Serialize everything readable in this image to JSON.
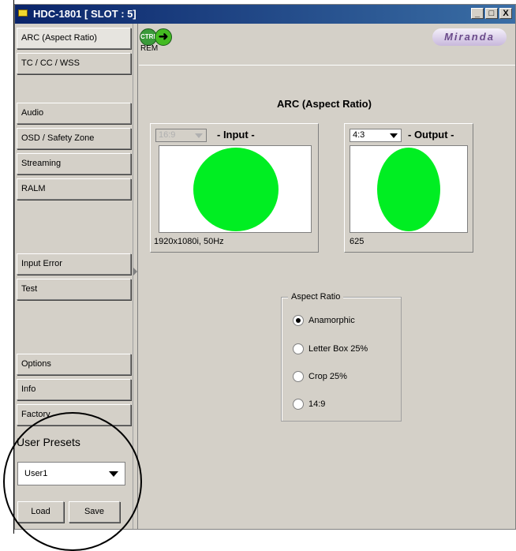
{
  "window": {
    "title": "HDC-1801 [ SLOT : 5]",
    "minimize": "_",
    "maximize": "□",
    "close": "X"
  },
  "sidebar": {
    "items": [
      {
        "label": "ARC (Aspect Ratio)",
        "selected": true
      },
      {
        "label": "TC / CC / WSS"
      },
      {
        "label": "Audio"
      },
      {
        "label": "OSD / Safety Zone"
      },
      {
        "label": "Streaming"
      },
      {
        "label": "RALM"
      },
      {
        "label": "Input Error"
      },
      {
        "label": "Test"
      },
      {
        "label": "Options"
      },
      {
        "label": "Info"
      },
      {
        "label": "Factory"
      }
    ],
    "presets_label": "User Presets",
    "preset_value": "User1",
    "load_label": "Load",
    "save_label": "Save"
  },
  "toolbar": {
    "ctrl_label": "CTRL",
    "rem_label": "REM",
    "logo_text": "Miranda"
  },
  "main": {
    "title": "ARC (Aspect Ratio)",
    "input": {
      "ratio": "16:9",
      "title": "- Input -",
      "resolution": "1920x1080i, 50Hz"
    },
    "output": {
      "ratio": "4:3",
      "title": "- Output -",
      "resolution": "625"
    },
    "aspect_ratio": {
      "legend": "Aspect Ratio",
      "options": [
        {
          "label": "Anamorphic",
          "selected": true
        },
        {
          "label": "Letter Box 25%",
          "selected": false
        },
        {
          "label": "Crop 25%",
          "selected": false
        },
        {
          "label": "14:9",
          "selected": false
        }
      ]
    }
  },
  "colors": {
    "titlebar": "#0a246a",
    "panel_bg": "#d4d0c8",
    "circle": "#00ee22"
  }
}
